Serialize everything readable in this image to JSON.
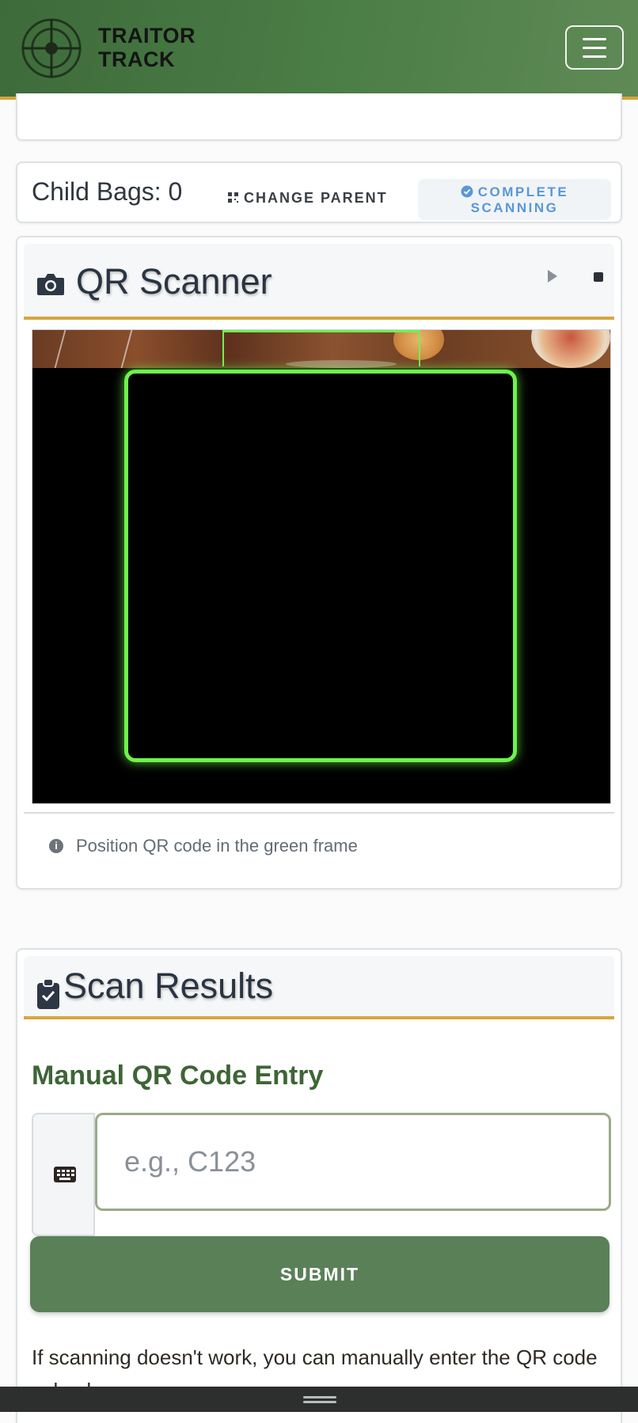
{
  "header": {
    "brand_line1": "TRAITOR",
    "brand_line2": "TRACK",
    "logo_icon": "crosshair-logo-icon",
    "menu_icon": "hamburger-menu-icon"
  },
  "child_bags": {
    "label": "Child Bags: 0",
    "change_parent_label": "CHANGE PARENT",
    "complete_line1": "COMPLETE",
    "complete_line2": "SCANNING"
  },
  "scanner": {
    "title": "QR Scanner",
    "hint": "Position QR code in the green frame",
    "frame_color": "#6df34a"
  },
  "results": {
    "title": "Scan Results",
    "manual_title": "Manual QR Code Entry",
    "input_placeholder": "e.g., C123",
    "input_value": "",
    "submit_label": "SUBMIT",
    "help_text": "If scanning doesn't work, you can manually enter the QR code value here."
  },
  "colors": {
    "header_green": "#4c7e47",
    "accent_gold": "#d7a63f",
    "submit_green": "#5a8058",
    "complete_blue": "#5a97d6"
  }
}
